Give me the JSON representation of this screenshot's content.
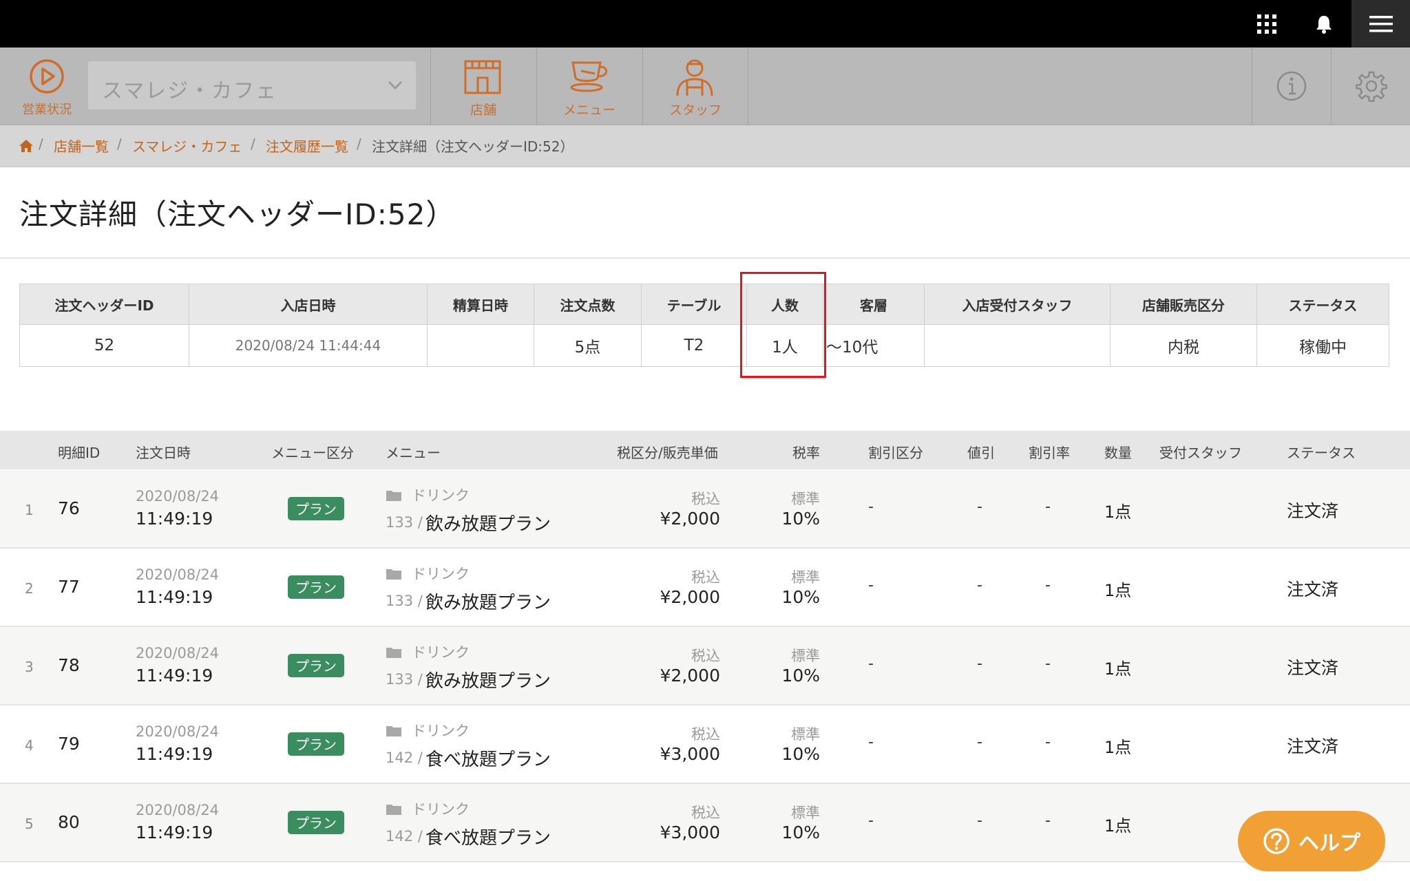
{
  "nav": {
    "status_label": "営業状況",
    "store_select_value": "スマレジ・カフェ",
    "shop_label": "店舗",
    "menu_label": "メニュー",
    "staff_label": "スタッフ"
  },
  "breadcrumb": {
    "items": [
      "店舗一覧",
      "スマレジ・カフェ",
      "注文履歴一覧"
    ],
    "current": "注文詳細（注文ヘッダーID:52）",
    "separator": "/"
  },
  "page_title": "注文詳細（注文ヘッダーID:52）",
  "header_table": {
    "columns": [
      "注文ヘッダーID",
      "入店日時",
      "精算日時",
      "注文点数",
      "テーブル",
      "人数",
      "客層",
      "入店受付スタッフ",
      "店舗販売区分",
      "ステータス"
    ],
    "values": [
      "52",
      "2020/08/24 11:44:44",
      "",
      "5点",
      "T2",
      "1人",
      "〜10代",
      "",
      "内税",
      "稼働中"
    ]
  },
  "detail_table": {
    "columns": [
      "明細ID",
      "注文日時",
      "メニュー区分",
      "メニュー",
      "税区分/販売単価",
      "税率",
      "割引区分",
      "値引",
      "割引率",
      "数量",
      "受付スタッフ",
      "ステータス"
    ],
    "rows": [
      {
        "index": "1",
        "id": "76",
        "date": "2020/08/24",
        "time": "11:49:19",
        "badge": "プラン",
        "category": "ドリンク",
        "menu_no": "133 /",
        "menu": "飲み放題プラン",
        "tax_type": "税込",
        "price": "¥2,000",
        "rate_type": "標準",
        "rate": "10%",
        "discount_type": "-",
        "discount": "-",
        "discount_rate": "-",
        "qty": "1点",
        "staff": "",
        "status": "注文済"
      },
      {
        "index": "2",
        "id": "77",
        "date": "2020/08/24",
        "time": "11:49:19",
        "badge": "プラン",
        "category": "ドリンク",
        "menu_no": "133 /",
        "menu": "飲み放題プラン",
        "tax_type": "税込",
        "price": "¥2,000",
        "rate_type": "標準",
        "rate": "10%",
        "discount_type": "-",
        "discount": "-",
        "discount_rate": "-",
        "qty": "1点",
        "staff": "",
        "status": "注文済"
      },
      {
        "index": "3",
        "id": "78",
        "date": "2020/08/24",
        "time": "11:49:19",
        "badge": "プラン",
        "category": "ドリンク",
        "menu_no": "133 /",
        "menu": "飲み放題プラン",
        "tax_type": "税込",
        "price": "¥2,000",
        "rate_type": "標準",
        "rate": "10%",
        "discount_type": "-",
        "discount": "-",
        "discount_rate": "-",
        "qty": "1点",
        "staff": "",
        "status": "注文済"
      },
      {
        "index": "4",
        "id": "79",
        "date": "2020/08/24",
        "time": "11:49:19",
        "badge": "プラン",
        "category": "ドリンク",
        "menu_no": "142 /",
        "menu": "食べ放題プラン",
        "tax_type": "税込",
        "price": "¥3,000",
        "rate_type": "標準",
        "rate": "10%",
        "discount_type": "-",
        "discount": "-",
        "discount_rate": "-",
        "qty": "1点",
        "staff": "",
        "status": "注文済"
      },
      {
        "index": "5",
        "id": "80",
        "date": "2020/08/24",
        "time": "11:49:19",
        "badge": "プラン",
        "category": "ドリンク",
        "menu_no": "142 /",
        "menu": "食べ放題プラン",
        "tax_type": "税込",
        "price": "¥3,000",
        "rate_type": "標準",
        "rate": "10%",
        "discount_type": "-",
        "discount": "-",
        "discount_rate": "-",
        "qty": "1点",
        "staff": "",
        "status": ""
      }
    ]
  },
  "help_label": "ヘルプ",
  "colors": {
    "accent": "#cf6e2a",
    "badge_green": "#3a8d5e",
    "highlight_red": "#e8141c",
    "help_orange": "#f0a035"
  },
  "icons": [
    "apps-grid-icon",
    "bell-icon",
    "hamburger-menu-icon",
    "play-circle-icon",
    "chevron-down-icon",
    "shop-icon",
    "cafe-menu-icon",
    "staff-icon",
    "info-icon",
    "gear-icon",
    "home-icon",
    "folder-icon",
    "help-circle-icon"
  ]
}
